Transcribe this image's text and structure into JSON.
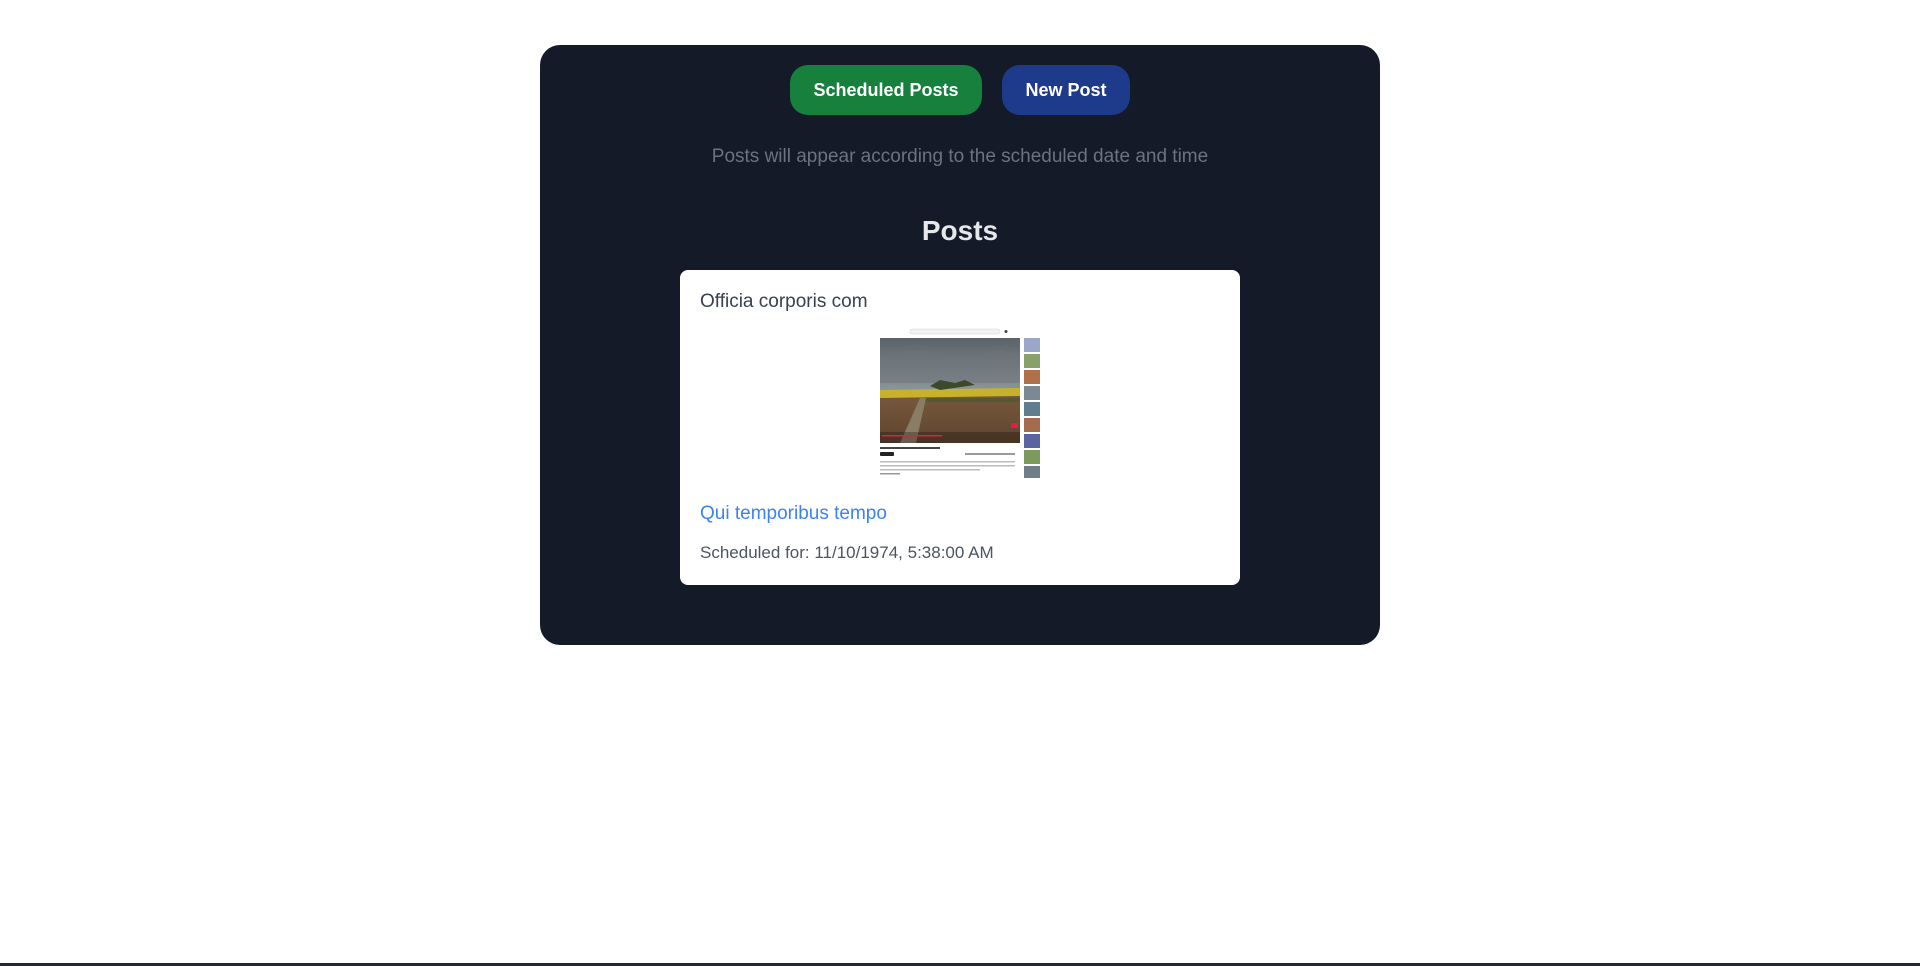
{
  "toolbar": {
    "scheduled_label": "Scheduled Posts",
    "new_label": "New Post",
    "colors": {
      "scheduled_bg": "#17803d",
      "new_bg": "#1e3a8a"
    }
  },
  "subtitle": "Posts will appear according to the scheduled date and time",
  "posts_heading": "Posts",
  "posts": [
    {
      "text": "Officia corporis com",
      "image_icon": "post-thumbnail-video-screenshot",
      "link": "Qui temporibus tempo",
      "schedule_prefix": "Scheduled for:",
      "schedule_value": "11/10/1974, 5:38:00 AM",
      "schedule_full": "Scheduled for: 11/10/1974, 5:38:00 AM"
    }
  ],
  "theme": {
    "panel_bg": "#141a28",
    "link_color": "#3b82f6"
  }
}
